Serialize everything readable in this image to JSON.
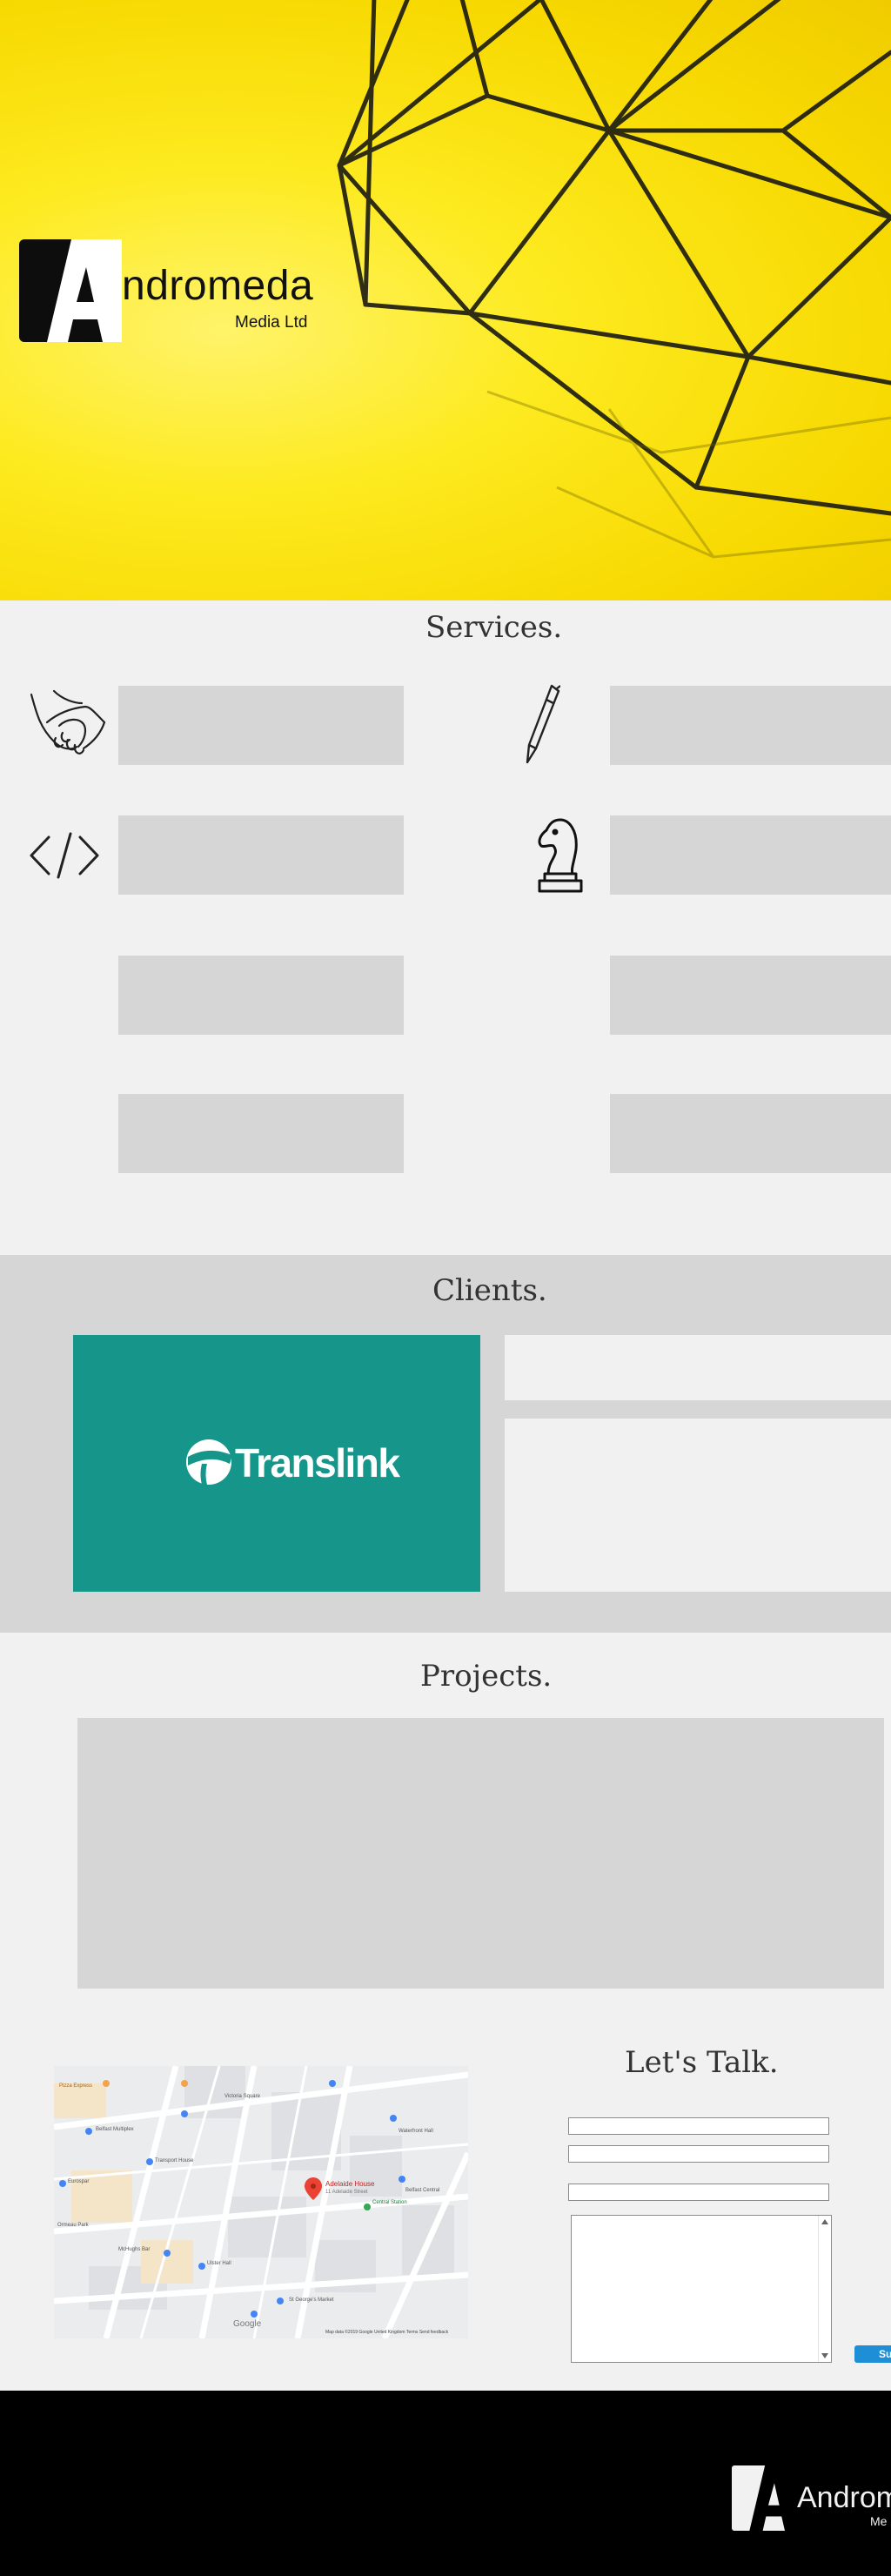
{
  "brand": {
    "name": "ndromeda",
    "initial": "A",
    "subtitle": "Media Ltd",
    "colors": {
      "hero_yellow": "#f9de00",
      "ink": "#111111",
      "panel_grey": "#d6d6d6",
      "page_bg": "#f1f1f1",
      "teal": "#16968a",
      "button_blue": "#1e8fd6"
    }
  },
  "services": {
    "title": "Services.",
    "icons": [
      "handshake-icon",
      "pen-icon",
      "code-icon",
      "chess-knight-icon"
    ]
  },
  "clients": {
    "title": "Clients.",
    "featured_client": "Translink"
  },
  "projects": {
    "title": "Projects."
  },
  "map": {
    "place": "Adelaide House",
    "place_sub": "11 Adelaide Street",
    "labels": [
      "Victoria Square",
      "Belfast Multiplex",
      "Transport House",
      "Pizza Express",
      "Waterfront Hall",
      "Belfast Central",
      "Eurospar",
      "Central Station",
      "Ulster Hall",
      "McHughs Bar",
      "St George's Market",
      "Ormeau Park",
      "Google"
    ],
    "footer_text": "Map data ©2019 Google   United Kingdom   Terms   Send feedback"
  },
  "contact": {
    "title": "Let's Talk.",
    "submit_label": "Su"
  },
  "footer": {
    "brand_word": "Androme",
    "brand_sub": "Me"
  }
}
